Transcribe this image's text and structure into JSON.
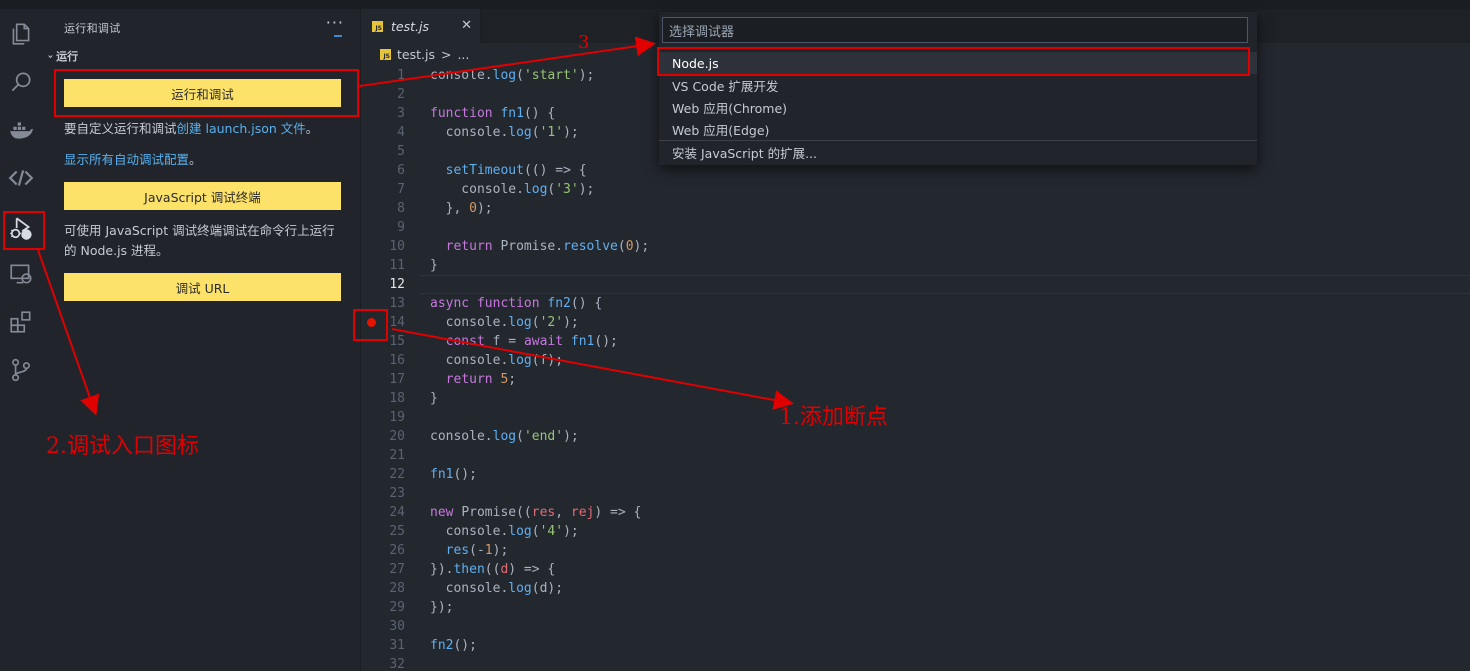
{
  "sidebar": {
    "title": "运行和调试",
    "more": "···",
    "section": "运行",
    "run_button": "运行和调试",
    "hint_prefix": "要自定义运行和调试",
    "hint_link": "创建 launch.json 文件",
    "hint_suffix": "。",
    "show_all_link": "显示所有自动调试配置",
    "show_all_suffix": "。",
    "terminal_button": "JavaScript 调试终端",
    "terminal_desc_line1": "可使用 JavaScript 调试终端调试在命令行上运行",
    "terminal_desc_line2": "的 Node.js 进程。",
    "url_button": "调试 URL"
  },
  "activity_icons": [
    "files-icon",
    "search-icon",
    "docker-icon",
    "source-link-icon",
    "run-debug-icon",
    "remote-explorer-icon",
    "extensions-icon",
    "source-control-icon"
  ],
  "editor": {
    "tab_badge": "JS",
    "tab_label": "test.js",
    "tab_close": "✕",
    "breadcrumb_file": "test.js",
    "breadcrumb_sep": ">",
    "breadcrumb_more": "..."
  },
  "quick_pick": {
    "placeholder": "选择调试器",
    "items": [
      "Node.js",
      "VS Code 扩展开发",
      "Web 应用(Chrome)",
      "Web 应用(Edge)"
    ],
    "extra": "安装 JavaScript 的扩展..."
  },
  "annotations": {
    "step1": "1.添加断点",
    "step2": "2.调试入口图标",
    "step3": "3"
  },
  "code": {
    "current_line": 12,
    "breakpoint_line": 14,
    "lines": [
      [
        [
          "pl",
          "console."
        ],
        [
          "fn",
          "log"
        ],
        [
          "pl",
          "("
        ],
        [
          "str",
          "'start'"
        ],
        [
          "pl",
          ");"
        ]
      ],
      [],
      [
        [
          "kw",
          "function "
        ],
        [
          "fn",
          "fn1"
        ],
        [
          "pl",
          "() {"
        ]
      ],
      [
        [
          "pl",
          "  console."
        ],
        [
          "fn",
          "log"
        ],
        [
          "pl",
          "("
        ],
        [
          "str",
          "'1'"
        ],
        [
          "pl",
          ");"
        ]
      ],
      [],
      [
        [
          "pl",
          "  "
        ],
        [
          "fn",
          "setTimeout"
        ],
        [
          "pl",
          "(() => {"
        ]
      ],
      [
        [
          "pl",
          "    console."
        ],
        [
          "fn",
          "log"
        ],
        [
          "pl",
          "("
        ],
        [
          "str",
          "'3'"
        ],
        [
          "pl",
          ");"
        ]
      ],
      [
        [
          "pl",
          "  }, "
        ],
        [
          "num",
          "0"
        ],
        [
          "pl",
          ");"
        ]
      ],
      [],
      [
        [
          "kw",
          "  return "
        ],
        [
          "pl",
          "Promise."
        ],
        [
          "fn",
          "resolve"
        ],
        [
          "pl",
          "("
        ],
        [
          "num",
          "0"
        ],
        [
          "pl",
          ");"
        ]
      ],
      [
        [
          "pl",
          "}"
        ]
      ],
      [],
      [
        [
          "kw",
          "async function "
        ],
        [
          "fn",
          "fn2"
        ],
        [
          "pl",
          "() {"
        ]
      ],
      [
        [
          "pl",
          "  console."
        ],
        [
          "fn",
          "log"
        ],
        [
          "pl",
          "("
        ],
        [
          "str",
          "'2'"
        ],
        [
          "pl",
          ");"
        ]
      ],
      [
        [
          "kw",
          "  const "
        ],
        [
          "pl",
          "f = "
        ],
        [
          "kw",
          "await "
        ],
        [
          "fn",
          "fn1"
        ],
        [
          "pl",
          "();"
        ]
      ],
      [
        [
          "pl",
          "  console."
        ],
        [
          "fn",
          "log"
        ],
        [
          "pl",
          "(f);"
        ]
      ],
      [
        [
          "kw",
          "  return "
        ],
        [
          "num",
          "5"
        ],
        [
          "pl",
          ";"
        ]
      ],
      [
        [
          "pl",
          "}"
        ]
      ],
      [],
      [
        [
          "pl",
          "console."
        ],
        [
          "fn",
          "log"
        ],
        [
          "pl",
          "("
        ],
        [
          "str",
          "'end'"
        ],
        [
          "pl",
          ");"
        ]
      ],
      [],
      [
        [
          "fn",
          "fn1"
        ],
        [
          "pl",
          "();"
        ]
      ],
      [],
      [
        [
          "kw",
          "new "
        ],
        [
          "pl",
          "Promise(("
        ],
        [
          "prm",
          "res"
        ],
        [
          "pl",
          ", "
        ],
        [
          "prm",
          "rej"
        ],
        [
          "pl",
          ") => {"
        ]
      ],
      [
        [
          "pl",
          "  console."
        ],
        [
          "fn",
          "log"
        ],
        [
          "pl",
          "("
        ],
        [
          "str",
          "'4'"
        ],
        [
          "pl",
          ");"
        ]
      ],
      [
        [
          "pl",
          "  "
        ],
        [
          "fn",
          "res"
        ],
        [
          "pl",
          "(-"
        ],
        [
          "num",
          "1"
        ],
        [
          "pl",
          ");"
        ]
      ],
      [
        [
          "pl",
          "})."
        ],
        [
          "fn",
          "then"
        ],
        [
          "pl",
          "(("
        ],
        [
          "prm",
          "d"
        ],
        [
          "pl",
          ") => {"
        ]
      ],
      [
        [
          "pl",
          "  console."
        ],
        [
          "fn",
          "log"
        ],
        [
          "pl",
          "(d);"
        ]
      ],
      [
        [
          "pl",
          "});"
        ]
      ],
      [],
      [
        [
          "fn",
          "fn2"
        ],
        [
          "pl",
          "();"
        ]
      ],
      []
    ]
  }
}
